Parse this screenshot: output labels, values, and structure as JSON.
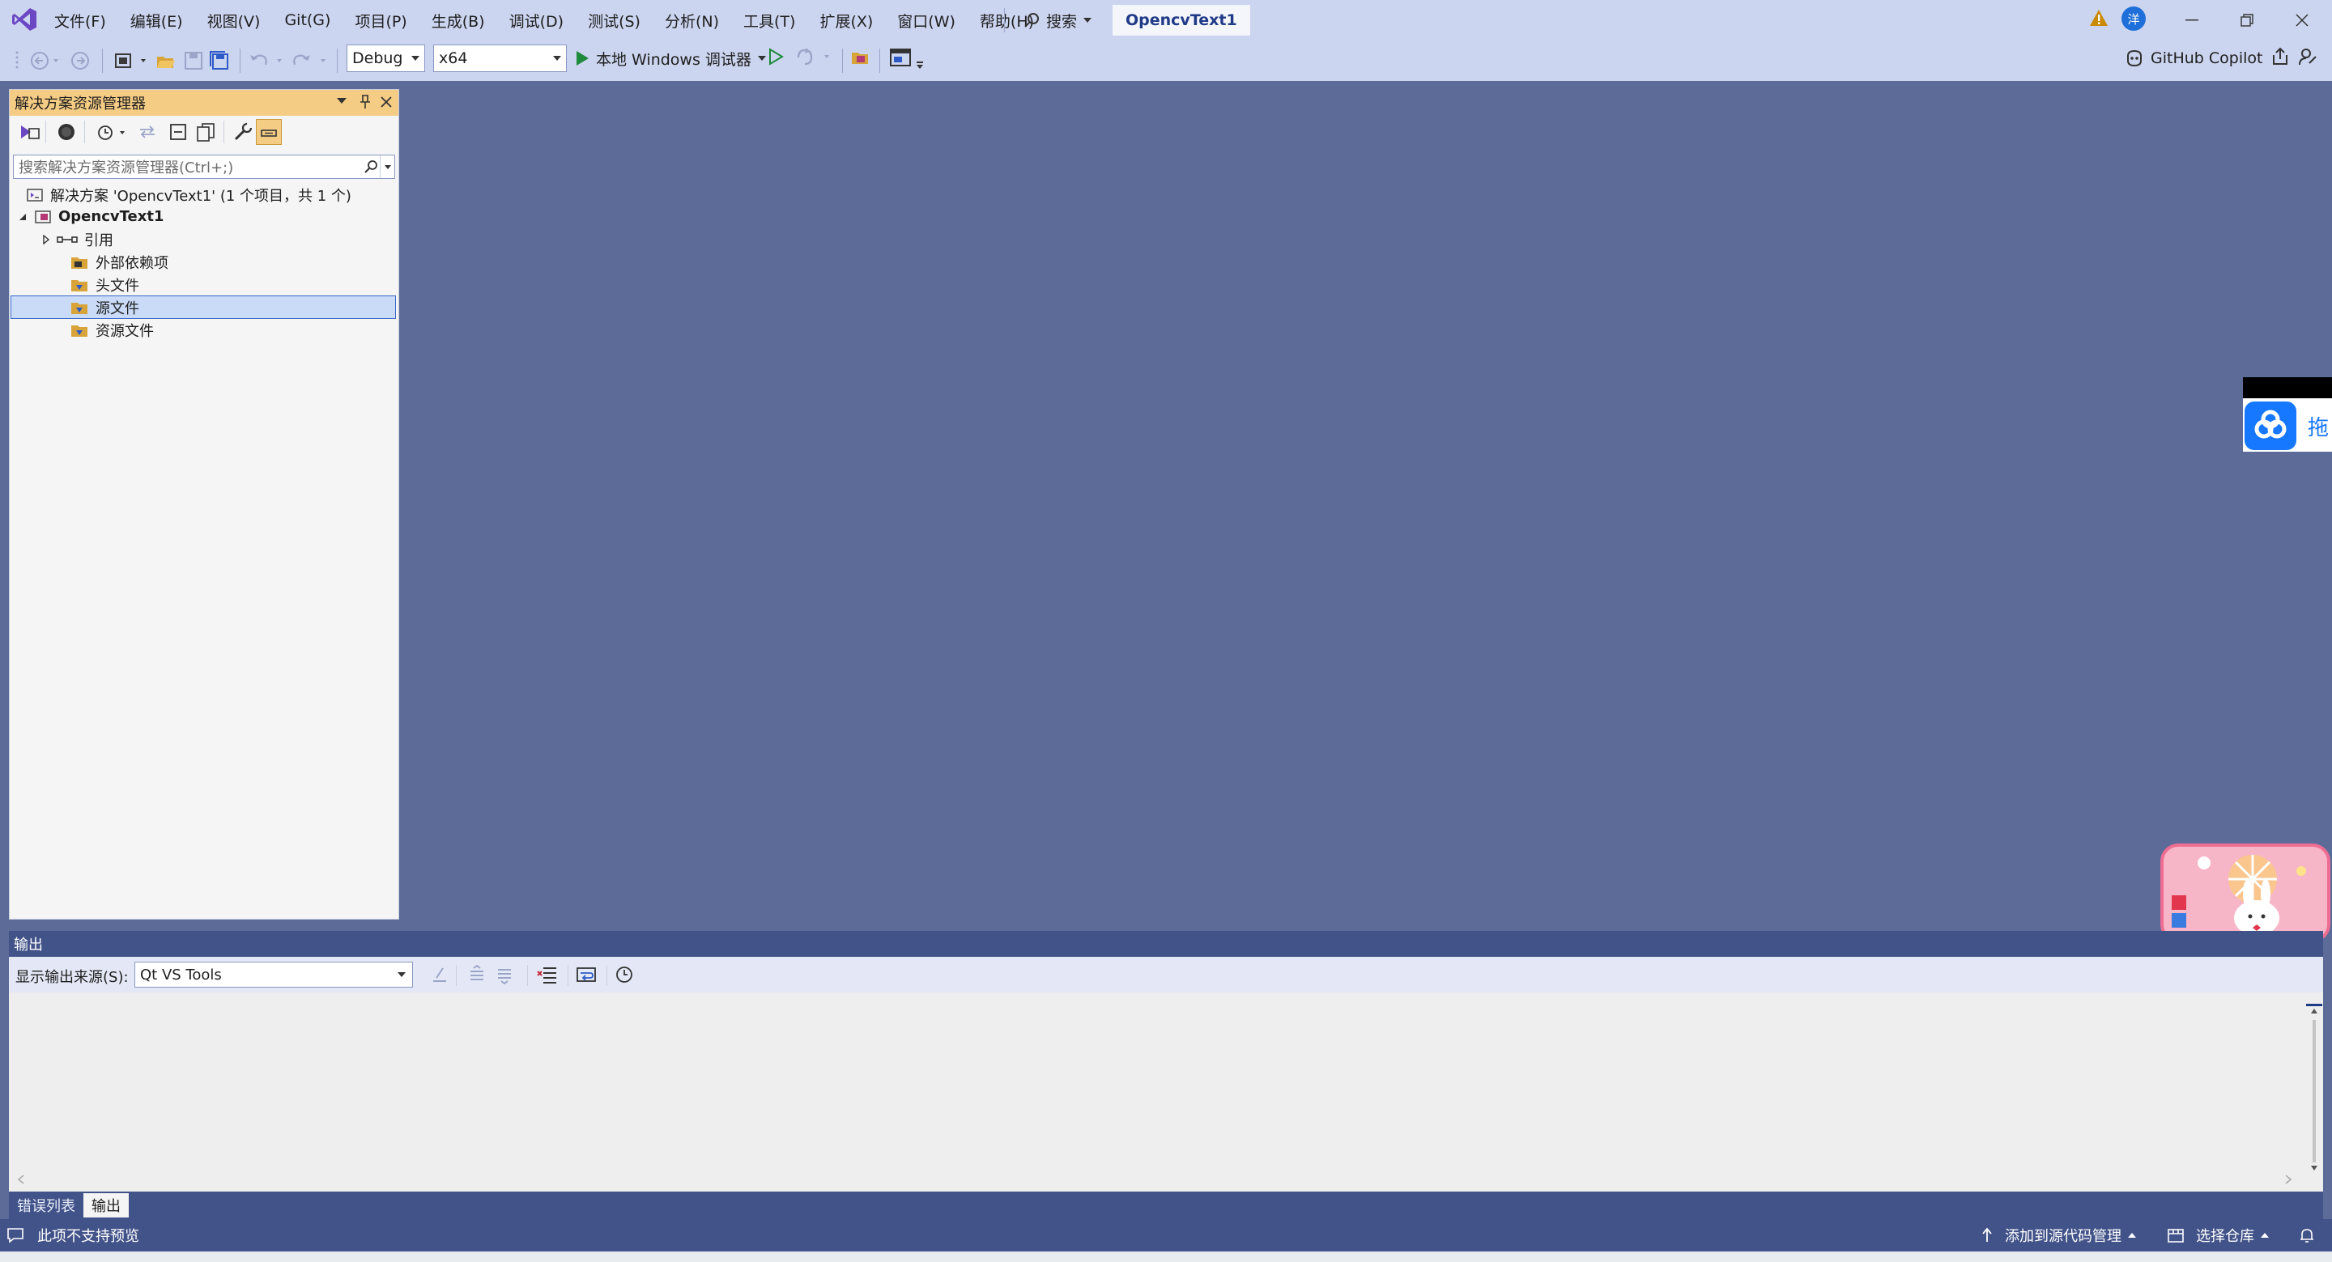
{
  "menu": {
    "items": [
      "文件(F)",
      "编辑(E)",
      "视图(V)",
      "Git(G)",
      "项目(P)",
      "生成(B)",
      "调试(D)",
      "测试(S)",
      "分析(N)",
      "工具(T)",
      "扩展(X)",
      "窗口(W)",
      "帮助(H)"
    ],
    "search_label": "搜索",
    "project_name": "OpencvText1",
    "user_initial": "洋"
  },
  "toolbar": {
    "config_value": "Debug",
    "platform_value": "x64",
    "run_label": "本地 Windows 调试器",
    "copilot_label": "GitHub Copilot"
  },
  "solution_explorer": {
    "title": "解决方案资源管理器",
    "search_placeholder": "搜索解决方案资源管理器(Ctrl+;)",
    "tree": {
      "solution": "解决方案 'OpencvText1' (1 个项目，共 1 个)",
      "project": "OpencvText1",
      "references": "引用",
      "external_deps": "外部依赖项",
      "header_files": "头文件",
      "source_files": "源文件",
      "resource_files": "资源文件"
    }
  },
  "output": {
    "title": "输出",
    "source_label": "显示输出来源(S):",
    "source_value": "Qt VS Tools",
    "tabs": [
      "错误列表",
      "输出"
    ],
    "active_tab": "输出"
  },
  "statusbar": {
    "left_text": "此项不支持预览",
    "add_source_control": "添加到源代码管理",
    "select_repo": "选择仓库"
  },
  "overlay": {
    "cloud_text": "拖"
  },
  "colors": {
    "accent": "#68217a",
    "editor_bg": "#5d6b99",
    "panel_header": "#f5cc84",
    "statusbar": "#425389"
  }
}
